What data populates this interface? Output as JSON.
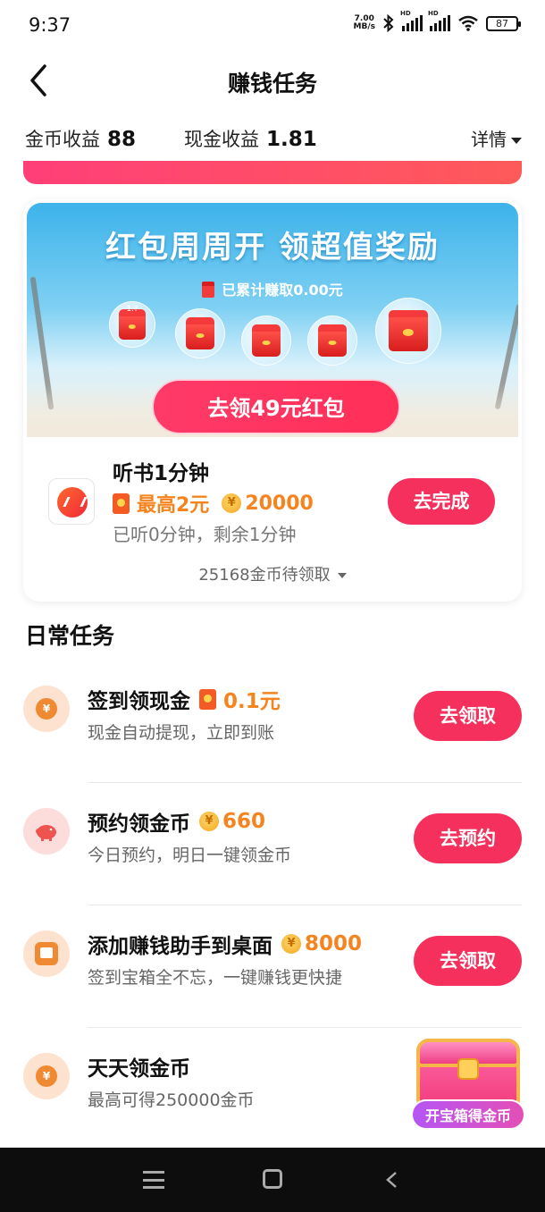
{
  "status_bar": {
    "time": "9:37",
    "net_speed_value": "7.00",
    "net_speed_unit": "MB/s",
    "battery": "87",
    "signal_label": "HD"
  },
  "header": {
    "title": "赚钱任务",
    "back_icon": "chevron-left-icon"
  },
  "income": {
    "coin_label": "金币收益",
    "coin_value": "88",
    "cash_label": "现金收益",
    "cash_value": "1.81",
    "details_label": "详情"
  },
  "red_packet_card": {
    "banner_title": "红包周周开 领超值奖励",
    "earned_text": "已累计赚取0.00元",
    "bubble_mark": "1.?",
    "claim_button": "去领49元红包",
    "task": {
      "title": "听书1分钟",
      "cash_reward": "最高2元",
      "coin_reward": "20000",
      "coin_symbol": "¥",
      "progress_text": "已听0分钟，剩余1分钟",
      "button": "去完成"
    },
    "pending_text": "25168金币待领取"
  },
  "daily": {
    "title": "日常任务",
    "tasks": [
      {
        "title": "签到领现金",
        "reward_type": "cash",
        "reward": "0.1元",
        "subtitle": "现金自动提现，立即到账",
        "button": "去领取",
        "icon": "yuan-coin-icon",
        "icon_glyph": "¥",
        "circle_color": "#fde3cf",
        "inner_color": "#f08a32"
      },
      {
        "title": "预约领金币",
        "reward_type": "coin",
        "reward": "660",
        "subtitle": "今日预约，明日一键领金币",
        "button": "去预约",
        "icon": "piggy-bank-icon",
        "icon_glyph": "",
        "circle_color": "#fddcdc",
        "inner_color": "#ef5350"
      },
      {
        "title": "添加赚钱助手到桌面",
        "reward_type": "coin",
        "reward": "8000",
        "subtitle": "签到宝箱全不忘，一键赚钱更快捷",
        "button": "去领取",
        "icon": "desktop-widget-icon",
        "icon_glyph": "",
        "circle_color": "#fde3cf",
        "inner_color": "#f08a32"
      },
      {
        "title": "天天领金币",
        "reward_type": "none",
        "reward": "",
        "subtitle": "最高可得250000金币",
        "button": "",
        "icon": "yuan-coin-icon",
        "icon_glyph": "¥",
        "circle_color": "#fde3cf",
        "inner_color": "#f08a32"
      }
    ]
  },
  "chest": {
    "label": "开宝箱得金币",
    "icon": "treasure-chest-icon"
  },
  "colors": {
    "accent": "#f6305c",
    "reward_orange": "#f5841f",
    "banner_sky": "#3db3ea"
  }
}
